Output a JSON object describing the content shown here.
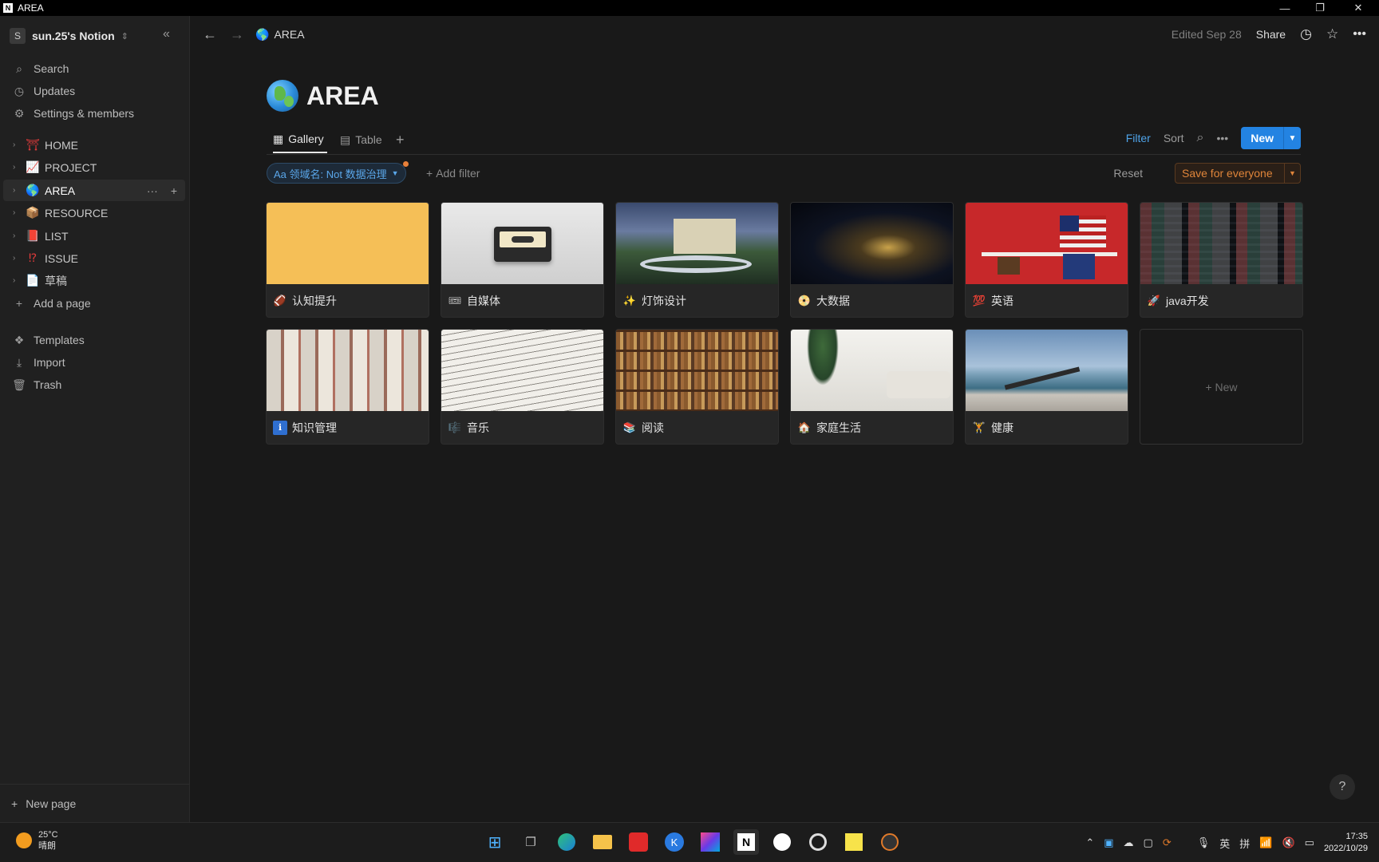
{
  "window": {
    "title": "AREA",
    "app_icon": "N"
  },
  "sidebar": {
    "workspace": {
      "avatar": "S",
      "name": "sun.25's Notion"
    },
    "nav": [
      {
        "label": "Search",
        "icon": "search-icon"
      },
      {
        "label": "Updates",
        "icon": "clock-icon"
      },
      {
        "label": "Settings & members",
        "icon": "gear-icon"
      }
    ],
    "pages": [
      {
        "label": "HOME",
        "emoji": "⛩"
      },
      {
        "label": "PROJECT",
        "emoji": "📈"
      },
      {
        "label": "AREA",
        "emoji": "🌎"
      },
      {
        "label": "RESOURCE",
        "emoji": "📦"
      },
      {
        "label": "LIST",
        "emoji": "📕"
      },
      {
        "label": "ISSUE",
        "emoji": "⁉"
      },
      {
        "label": "草稿",
        "emoji": "📄"
      }
    ],
    "add_page": "Add a page",
    "bottom": [
      {
        "label": "Templates",
        "icon": "templates-icon"
      },
      {
        "label": "Import",
        "icon": "import-icon"
      },
      {
        "label": "Trash",
        "icon": "trash-icon"
      }
    ],
    "new_page": "New page"
  },
  "topbar": {
    "breadcrumb": "AREA",
    "edited": "Edited Sep 28",
    "share": "Share"
  },
  "page": {
    "title": "AREA",
    "views": {
      "gallery": "Gallery",
      "table": "Table"
    },
    "actions": {
      "filter": "Filter",
      "sort": "Sort",
      "new": "New"
    },
    "filter_chip": "Aa 领域名: Not 数据治理",
    "add_filter": "Add filter",
    "reset": "Reset",
    "save": "Save for everyone"
  },
  "gallery": {
    "cards": [
      {
        "label": "认知提升",
        "icon": "🏈"
      },
      {
        "label": "自媒体",
        "icon": "🎟"
      },
      {
        "label": "灯饰设计",
        "icon": "✨"
      },
      {
        "label": "大数据",
        "icon": "📀"
      },
      {
        "label": "英语",
        "icon": "💯"
      },
      {
        "label": "java开发",
        "icon": "🚀"
      },
      {
        "label": "知识管理",
        "icon": "ℹ"
      },
      {
        "label": "音乐",
        "icon": "🎼"
      },
      {
        "label": "阅读",
        "icon": "📚"
      },
      {
        "label": "家庭生活",
        "icon": "🏠"
      },
      {
        "label": "健康",
        "icon": "🏋"
      }
    ],
    "new_card": "+ New"
  },
  "taskbar": {
    "weather_temp": "25°C",
    "weather_desc": "晴朗",
    "ime1": "英",
    "ime2": "拼",
    "time": "17:35",
    "date": "2022/10/29"
  }
}
